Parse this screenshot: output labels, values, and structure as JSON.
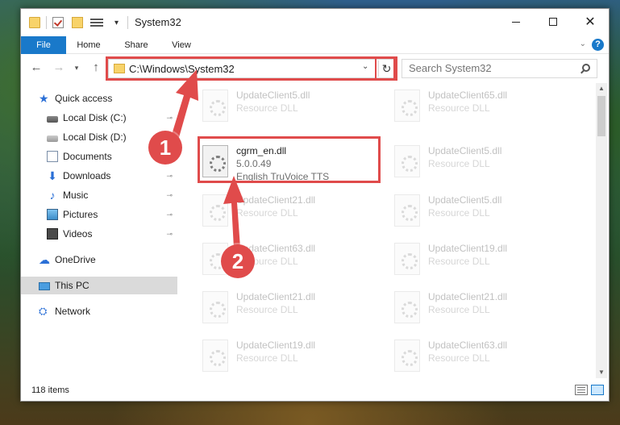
{
  "window": {
    "title": "System32",
    "controls": {
      "minimize": "minimize",
      "maximize": "maximize",
      "close": "✕"
    }
  },
  "quick_access_toolbar": {
    "icons": [
      "folder-icon",
      "properties-icon",
      "new-folder-icon",
      "customize-icon"
    ],
    "caret": "▾"
  },
  "ribbon": {
    "tabs": [
      {
        "label": "File",
        "active": true
      },
      {
        "label": "Home"
      },
      {
        "label": "Share"
      },
      {
        "label": "View"
      }
    ],
    "help": "?"
  },
  "nav": {
    "back": "←",
    "forward": "→",
    "recent": "▾",
    "up": "↑",
    "address": "C:\\Windows\\System32",
    "dropdown": "⌄",
    "refresh": "↻"
  },
  "search": {
    "placeholder": "Search System32"
  },
  "sidebar": {
    "items": [
      {
        "label": "Quick access",
        "pinned": false
      },
      {
        "label": "Local Disk (C:)",
        "pinned": true
      },
      {
        "label": "Local Disk (D:)",
        "pinned": false
      },
      {
        "label": "Documents",
        "pinned": false
      },
      {
        "label": "Downloads",
        "pinned": true
      },
      {
        "label": "Music",
        "pinned": true
      },
      {
        "label": "Pictures",
        "pinned": true
      },
      {
        "label": "Videos",
        "pinned": true
      },
      {
        "label": "OneDrive",
        "pinned": false
      },
      {
        "label": "This PC",
        "pinned": false,
        "selected": true
      },
      {
        "label": "Network",
        "pinned": false
      }
    ],
    "pin_glyph": "📌"
  },
  "files": {
    "left": [
      {
        "name": "UpdateClient5.dll",
        "type": "Resource DLL",
        "faded": true
      },
      {
        "name": "cgrm_en.dll",
        "version": "5.0.0.49",
        "type": "English TruVoice TTS",
        "faded": false
      },
      {
        "name": "UpdateClient21.dll",
        "type": "Resource DLL",
        "faded": true
      },
      {
        "name": "UpdateClient63.dll",
        "type": "Resource DLL",
        "faded": true
      },
      {
        "name": "UpdateClient21.dll",
        "type": "Resource DLL",
        "faded": true
      },
      {
        "name": "UpdateClient19.dll",
        "type": "Resource DLL",
        "faded": true
      }
    ],
    "right": [
      {
        "name": "UpdateClient65.dll",
        "type": "Resource DLL",
        "faded": true
      },
      {
        "name": "UpdateClient5.dll",
        "type": "Resource DLL",
        "faded": true
      },
      {
        "name": "UpdateClient5.dll",
        "type": "Resource DLL",
        "faded": true
      },
      {
        "name": "UpdateClient19.dll",
        "type": "Resource DLL",
        "faded": true
      },
      {
        "name": "UpdateClient21.dll",
        "type": "Resource DLL",
        "faded": true
      },
      {
        "name": "UpdateClient63.dll",
        "type": "Resource DLL",
        "faded": true
      }
    ]
  },
  "status": {
    "count": "118 items"
  },
  "annotations": {
    "step1": "1",
    "step2": "2",
    "color": "#e04b4b"
  },
  "colors": {
    "accent": "#1979ca",
    "highlight": "#e04b4b",
    "selected_sidebar": "#dadada"
  }
}
